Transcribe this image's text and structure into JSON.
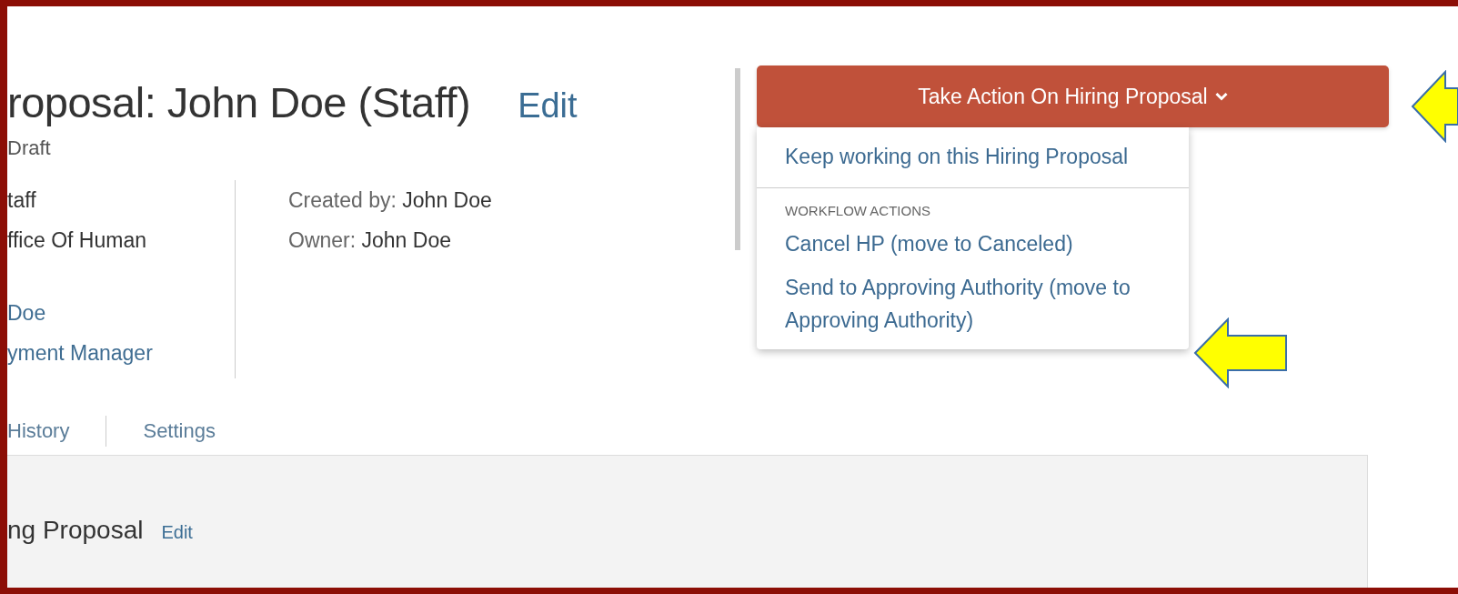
{
  "header": {
    "title": "roposal: John Doe (Staff)",
    "edit_link": "Edit",
    "status": "Draft"
  },
  "details_left": [
    {
      "kind": "plain",
      "lines": [
        "taff",
        "ffice Of Human"
      ]
    },
    {
      "kind": "link",
      "lines": [
        "Doe",
        "yment Manager"
      ]
    }
  ],
  "details_right": [
    {
      "label": "Created by:",
      "value": "John Doe"
    },
    {
      "label": "Owner:",
      "value": "John Doe"
    }
  ],
  "tabs": [
    {
      "label": "History"
    },
    {
      "label": "Settings"
    }
  ],
  "action_button": {
    "label": "Take Action On Hiring Proposal"
  },
  "action_menu": [
    {
      "kind": "item",
      "label": "Keep working on this Hiring Proposal"
    },
    {
      "kind": "divider"
    },
    {
      "kind": "heading",
      "label": "WORKFLOW ACTIONS"
    },
    {
      "kind": "item",
      "label": "Cancel HP (move to Canceled)"
    },
    {
      "kind": "item",
      "label": "Send to Approving Authority (move to Approving Authority)"
    }
  ],
  "section": {
    "title": "ng Proposal",
    "edit_link": "Edit"
  }
}
